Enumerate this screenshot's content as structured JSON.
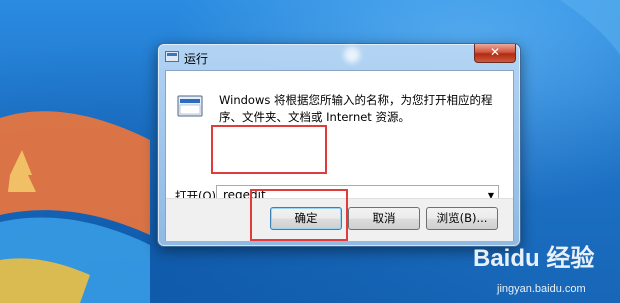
{
  "dialog": {
    "title": "运行",
    "close_label": "✕",
    "description": "Windows 将根据您所输入的名称，为您打开相应的程序、文件夹、文档或 Internet 资源。",
    "open_label": "打开(O):",
    "open_value": "regedit",
    "buttons": {
      "ok": "确定",
      "cancel": "取消",
      "browse": "浏览(B)..."
    }
  },
  "watermark": {
    "brand": "Baidu 经验",
    "url": "jingyan.baidu.com"
  },
  "colors": {
    "highlight": "#e23b3b",
    "desktop": "#1f75c6"
  }
}
